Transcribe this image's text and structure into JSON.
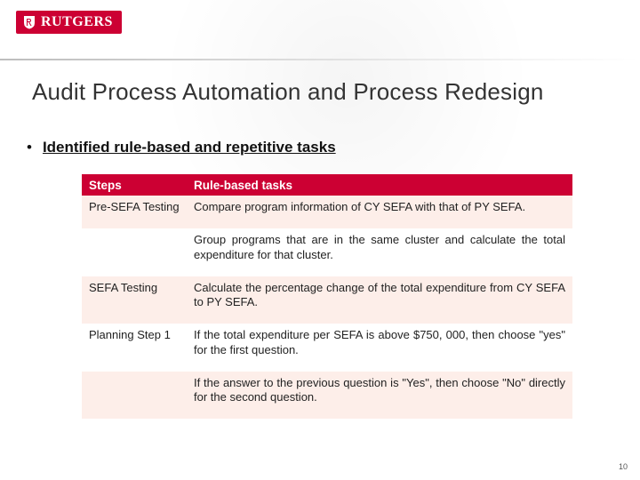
{
  "brand": {
    "logo_text": "RUTGERS"
  },
  "title": "Audit Process Automation and Process Redesign",
  "bullet": {
    "marker": "•",
    "text": "Identified rule-based and repetitive tasks"
  },
  "table": {
    "headers": {
      "col1": "Steps",
      "col2": "Rule-based tasks"
    },
    "rows": [
      {
        "step": "Pre-SEFA Testing",
        "task": "Compare program information of CY SEFA with that of PY SEFA."
      },
      {
        "step": "",
        "task": "Group programs that are in the same cluster and calculate the total expenditure for that cluster."
      },
      {
        "step": "SEFA Testing",
        "task": "Calculate the percentage change of the total expenditure from CY SEFA to PY SEFA."
      },
      {
        "step": "Planning Step 1",
        "task": "If the total expenditure per SEFA is above $750, 000, then choose \"yes\" for the first question."
      },
      {
        "step": "",
        "task": "If the answer to the previous question is \"Yes\", then choose \"No\" directly for the second question."
      }
    ]
  },
  "page_number": "10"
}
